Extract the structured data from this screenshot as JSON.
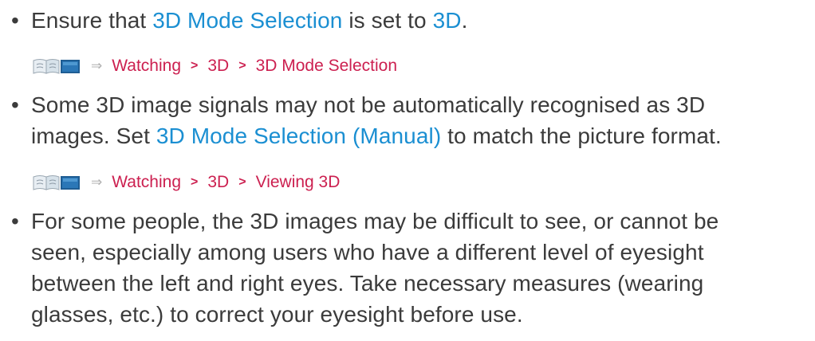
{
  "bullets": [
    {
      "parts": [
        "Ensure that ",
        "3D Mode Selection",
        " is set to ",
        "3D",
        "."
      ]
    },
    {
      "line1_parts": [
        "Some 3D image signals may not be automatically recognised as 3D"
      ],
      "line2_parts": [
        "images. Set ",
        "3D Mode Selection (Manual)",
        " to match the picture format."
      ]
    },
    {
      "lines": [
        "For some people, the 3D images may be difficult to see, or cannot be",
        "seen, especially among users who have a different level of eyesight",
        "between the left and right eyes. Take necessary measures (wearing",
        "glasses, etc.) to correct your eyesight before use."
      ]
    }
  ],
  "nav_paths": [
    {
      "icon": "ebook-icon",
      "arrow": "⇒",
      "items": [
        "Watching",
        "3D",
        "3D Mode Selection"
      ],
      "separator": ">"
    },
    {
      "icon": "ebook-icon",
      "arrow": "⇒",
      "items": [
        "Watching",
        "3D",
        "Viewing 3D"
      ],
      "separator": ">"
    }
  ],
  "bullet_char": "•",
  "colors": {
    "text": "#3b3b3b",
    "link": "#1b8fd2",
    "nav_link": "#cc2050"
  }
}
